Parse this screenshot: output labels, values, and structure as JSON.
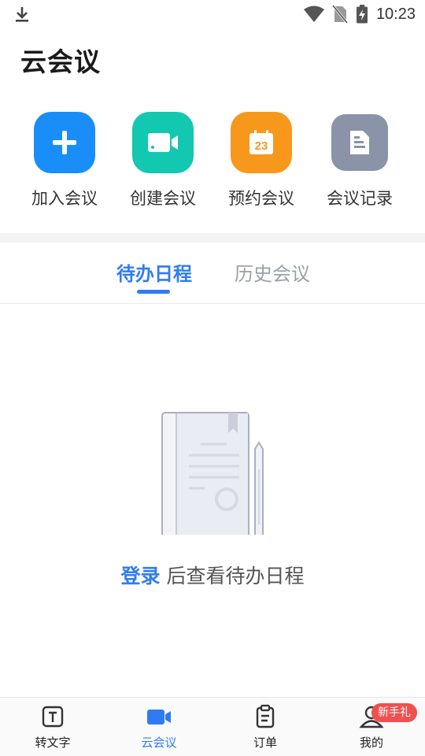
{
  "status_bar": {
    "time": "10:23"
  },
  "page": {
    "title": "云会议"
  },
  "actions": [
    {
      "label": "加入会议",
      "icon": "plus-icon",
      "color": "#1a8ef8"
    },
    {
      "label": "创建会议",
      "icon": "video-camera-icon",
      "color": "#12c8b1"
    },
    {
      "label": "预约会议",
      "icon": "calendar-icon",
      "color": "#f7981c",
      "calendar_day": "23"
    },
    {
      "label": "会议记录",
      "icon": "document-icon",
      "color": "#8a93a8"
    }
  ],
  "tabs": [
    {
      "label": "待办日程",
      "active": true
    },
    {
      "label": "历史会议",
      "active": false
    }
  ],
  "empty_state": {
    "login_link": "登录",
    "message": "后查看待办日程"
  },
  "bottom_nav": [
    {
      "label": "转文字",
      "icon": "text-convert-icon"
    },
    {
      "label": "云会议",
      "icon": "video-camera-icon",
      "active": true
    },
    {
      "label": "订单",
      "icon": "clipboard-icon"
    },
    {
      "label": "我的",
      "icon": "person-icon"
    }
  ],
  "badge": {
    "text": "新手礼"
  },
  "colors": {
    "accent": "#2f7cf2",
    "badge": "#f0504f"
  }
}
